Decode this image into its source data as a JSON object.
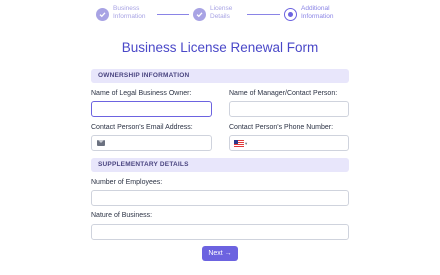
{
  "stepper": {
    "steps": [
      {
        "label_line1": "Business",
        "label_line2": "Information",
        "state": "complete"
      },
      {
        "label_line1": "License",
        "label_line2": "Details",
        "state": "complete"
      },
      {
        "label_line1": "Additional",
        "label_line2": "Information",
        "state": "active"
      }
    ]
  },
  "form": {
    "title": "Business License Renewal Form",
    "sections": [
      {
        "header": "OWNERSHIP INFORMATION",
        "fields": [
          {
            "label": "Name of Legal Business Owner:",
            "value": ""
          },
          {
            "label": "Name of Manager/Contact Person:",
            "value": ""
          },
          {
            "label": "Contact Person's Email Address:",
            "value": "",
            "icon": "mail-icon"
          },
          {
            "label": "Contact Person's Phone Number:",
            "value": "",
            "icon": "us-flag-icon",
            "country_caret": "▾"
          }
        ]
      },
      {
        "header": "SUPPLEMENTARY DETAILS",
        "fields": [
          {
            "label": "Number of Employees:",
            "value": ""
          },
          {
            "label": "Nature of Business:",
            "value": ""
          }
        ]
      }
    ],
    "next_label": "Next →"
  },
  "colors": {
    "accent": "#6c63e0",
    "title": "#4a48c8",
    "section_bg": "#e8e6fb",
    "step_complete": "#a8a3e4"
  }
}
